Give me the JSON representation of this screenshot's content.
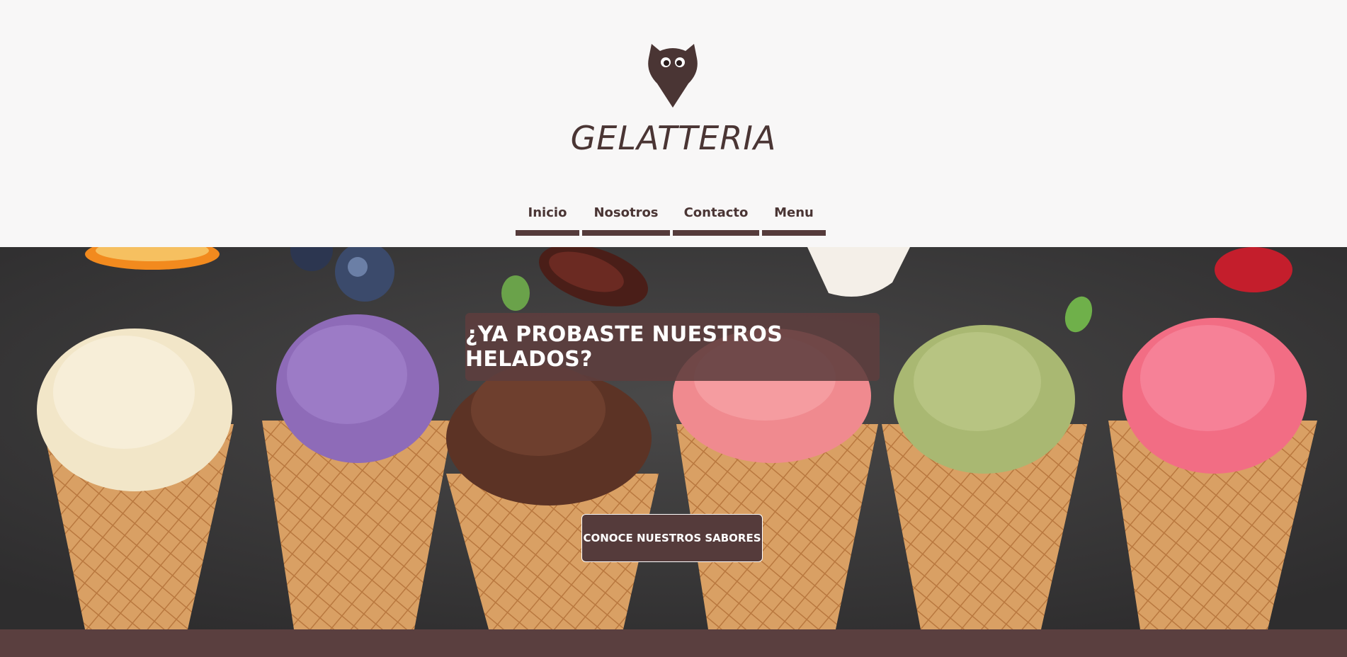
{
  "header": {
    "brand": "GELATTERIA",
    "logo_icon": "owl-icon",
    "nav": [
      {
        "label": "Inicio"
      },
      {
        "label": "Nosotros"
      },
      {
        "label": "Contacto"
      },
      {
        "label": "Menu"
      }
    ]
  },
  "hero": {
    "title": "¿YA PROBASTE NUESTROS HELADOS?",
    "cta_label": "CONOCE NUESTROS SABORES",
    "image": "ice-cream-cones-photo"
  },
  "colors": {
    "brand": "#553b3b",
    "text": "#4a3534",
    "background": "#f8f7f7"
  }
}
